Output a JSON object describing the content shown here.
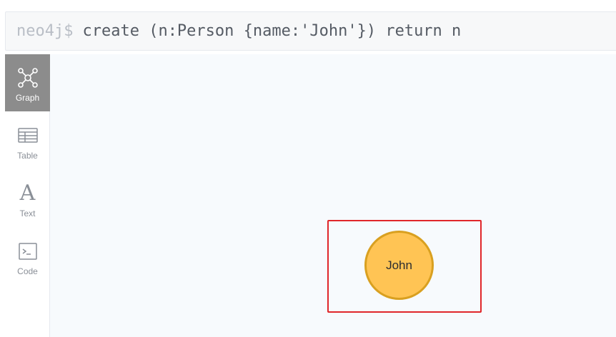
{
  "editor": {
    "prompt": "neo4j$",
    "query": "create (n:Person {name:'John'}) return n"
  },
  "sidebar": {
    "tabs": [
      {
        "id": "graph",
        "label": "Graph",
        "icon": "graph-icon",
        "active": true
      },
      {
        "id": "table",
        "label": "Table",
        "icon": "table-icon",
        "active": false
      },
      {
        "id": "text",
        "label": "Text",
        "icon": "text-icon",
        "active": false
      },
      {
        "id": "code",
        "label": "Code",
        "icon": "code-icon",
        "active": false
      }
    ],
    "text_glyph": "A"
  },
  "graph": {
    "nodes": [
      {
        "label": "Person",
        "caption": "John",
        "fill": "#ffc454",
        "stroke": "#d9a020"
      }
    ],
    "highlight_color": "#e0262a"
  },
  "colors": {
    "active_tab": "#8c8c8c",
    "canvas_bg": "#f7fafd",
    "editor_bg": "#f7f8f9"
  }
}
